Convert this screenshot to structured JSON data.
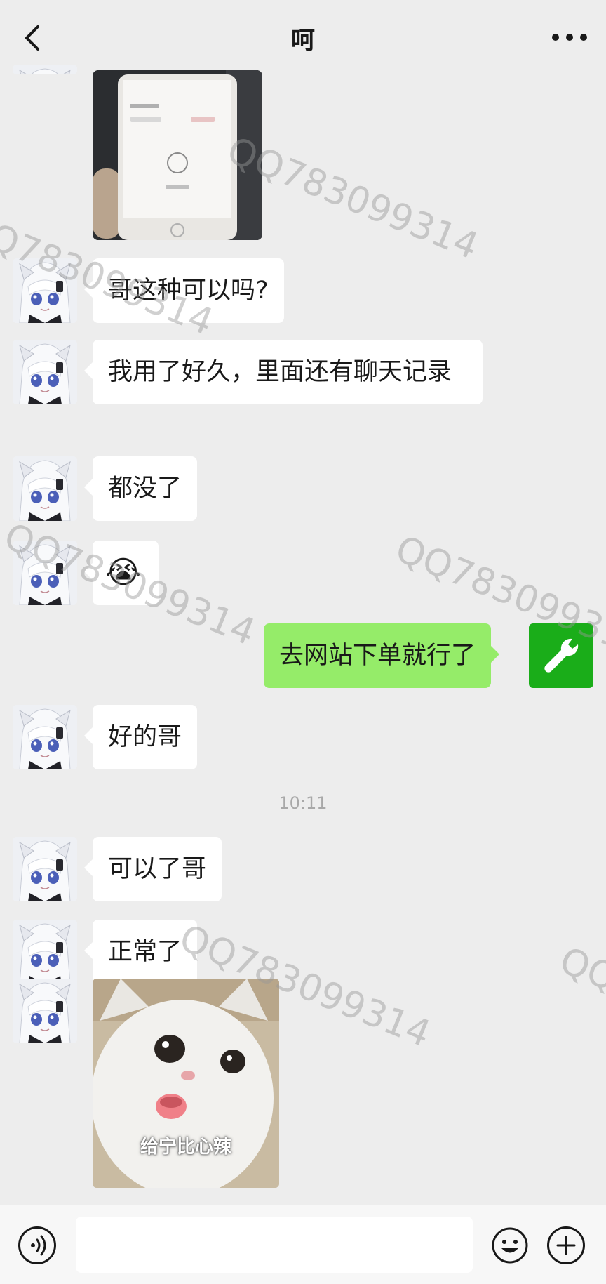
{
  "header": {
    "title": "呵",
    "back_icon": "chevron-left-icon",
    "more_icon": "more-dots-icon"
  },
  "messages": [
    {
      "side": "left",
      "type": "image",
      "content": "phone-photo"
    },
    {
      "side": "left",
      "type": "text",
      "text": "哥这种可以吗?"
    },
    {
      "side": "left",
      "type": "text",
      "text": "我用了好久，里面还有聊天记录"
    },
    {
      "side": "left",
      "type": "text",
      "text": "都没了"
    },
    {
      "side": "left",
      "type": "emoji",
      "emoji": "😭"
    },
    {
      "side": "right",
      "type": "text",
      "text": "去网站下单就行了"
    },
    {
      "side": "left",
      "type": "text",
      "text": "好的哥"
    },
    {
      "side": "left",
      "type": "text",
      "text": "可以了哥"
    },
    {
      "side": "left",
      "type": "text",
      "text": "正常了"
    },
    {
      "side": "left",
      "type": "sticker",
      "caption": "给宁比心辣"
    }
  ],
  "timestamp": "10:11",
  "watermark_text": "QQ783099314",
  "self_avatar_icon": "wrench-icon",
  "input_bar": {
    "voice_icon": "voice-icon",
    "emoji_icon": "smile-icon",
    "plus_icon": "plus-icon",
    "input_value": ""
  },
  "colors": {
    "background": "#ededed",
    "bubble_incoming": "#ffffff",
    "bubble_outgoing": "#95ec69",
    "self_avatar": "#1aad19"
  }
}
